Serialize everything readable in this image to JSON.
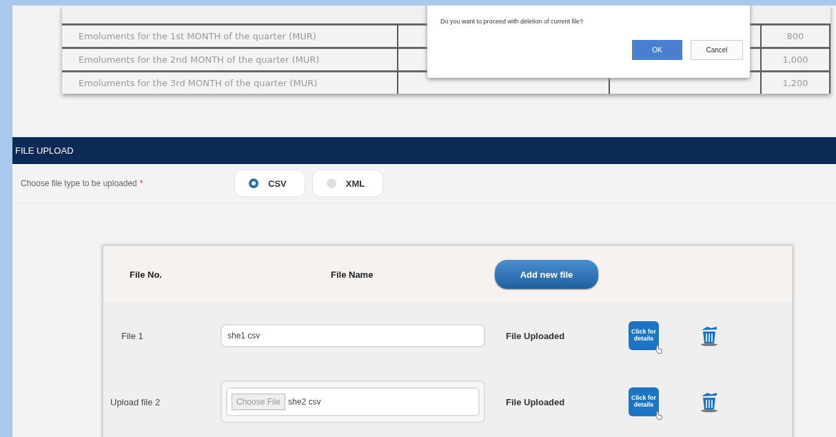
{
  "emoluments_table": {
    "rows": [
      {
        "label": "Emoluments for the 1st MONTH of the quarter (MUR)",
        "total": "800"
      },
      {
        "label": "Emoluments for the 2nd MONTH of the quarter (MUR)",
        "total": "1,000"
      },
      {
        "label": "Emoluments for the 3rd MONTH of the quarter (MUR)",
        "total": "1,200"
      }
    ]
  },
  "dialog": {
    "message": "Do you want to proceed with deletion of current file?",
    "buttons": [
      "OK",
      "Cancel"
    ]
  },
  "file_upload": {
    "title": "FILE UPLOAD",
    "file_type_label": "Choose file type to be uploaded",
    "required_mark": "*",
    "file_types": [
      {
        "label": "CSV",
        "selected": true
      },
      {
        "label": "XML",
        "selected": false
      }
    ],
    "columns": [
      "File No.",
      "File Name"
    ],
    "add_button": "Add new file",
    "files": [
      {
        "kind": "uploaded",
        "label": "File 1",
        "value": "she1 csv",
        "status": "File Uploaded",
        "details": "Click for details"
      },
      {
        "kind": "chooser",
        "label": "Upload file 2",
        "choose_button": "Choose File",
        "value": "she2 csv",
        "status": "File Uploaded",
        "details": "Click for details"
      }
    ]
  }
}
